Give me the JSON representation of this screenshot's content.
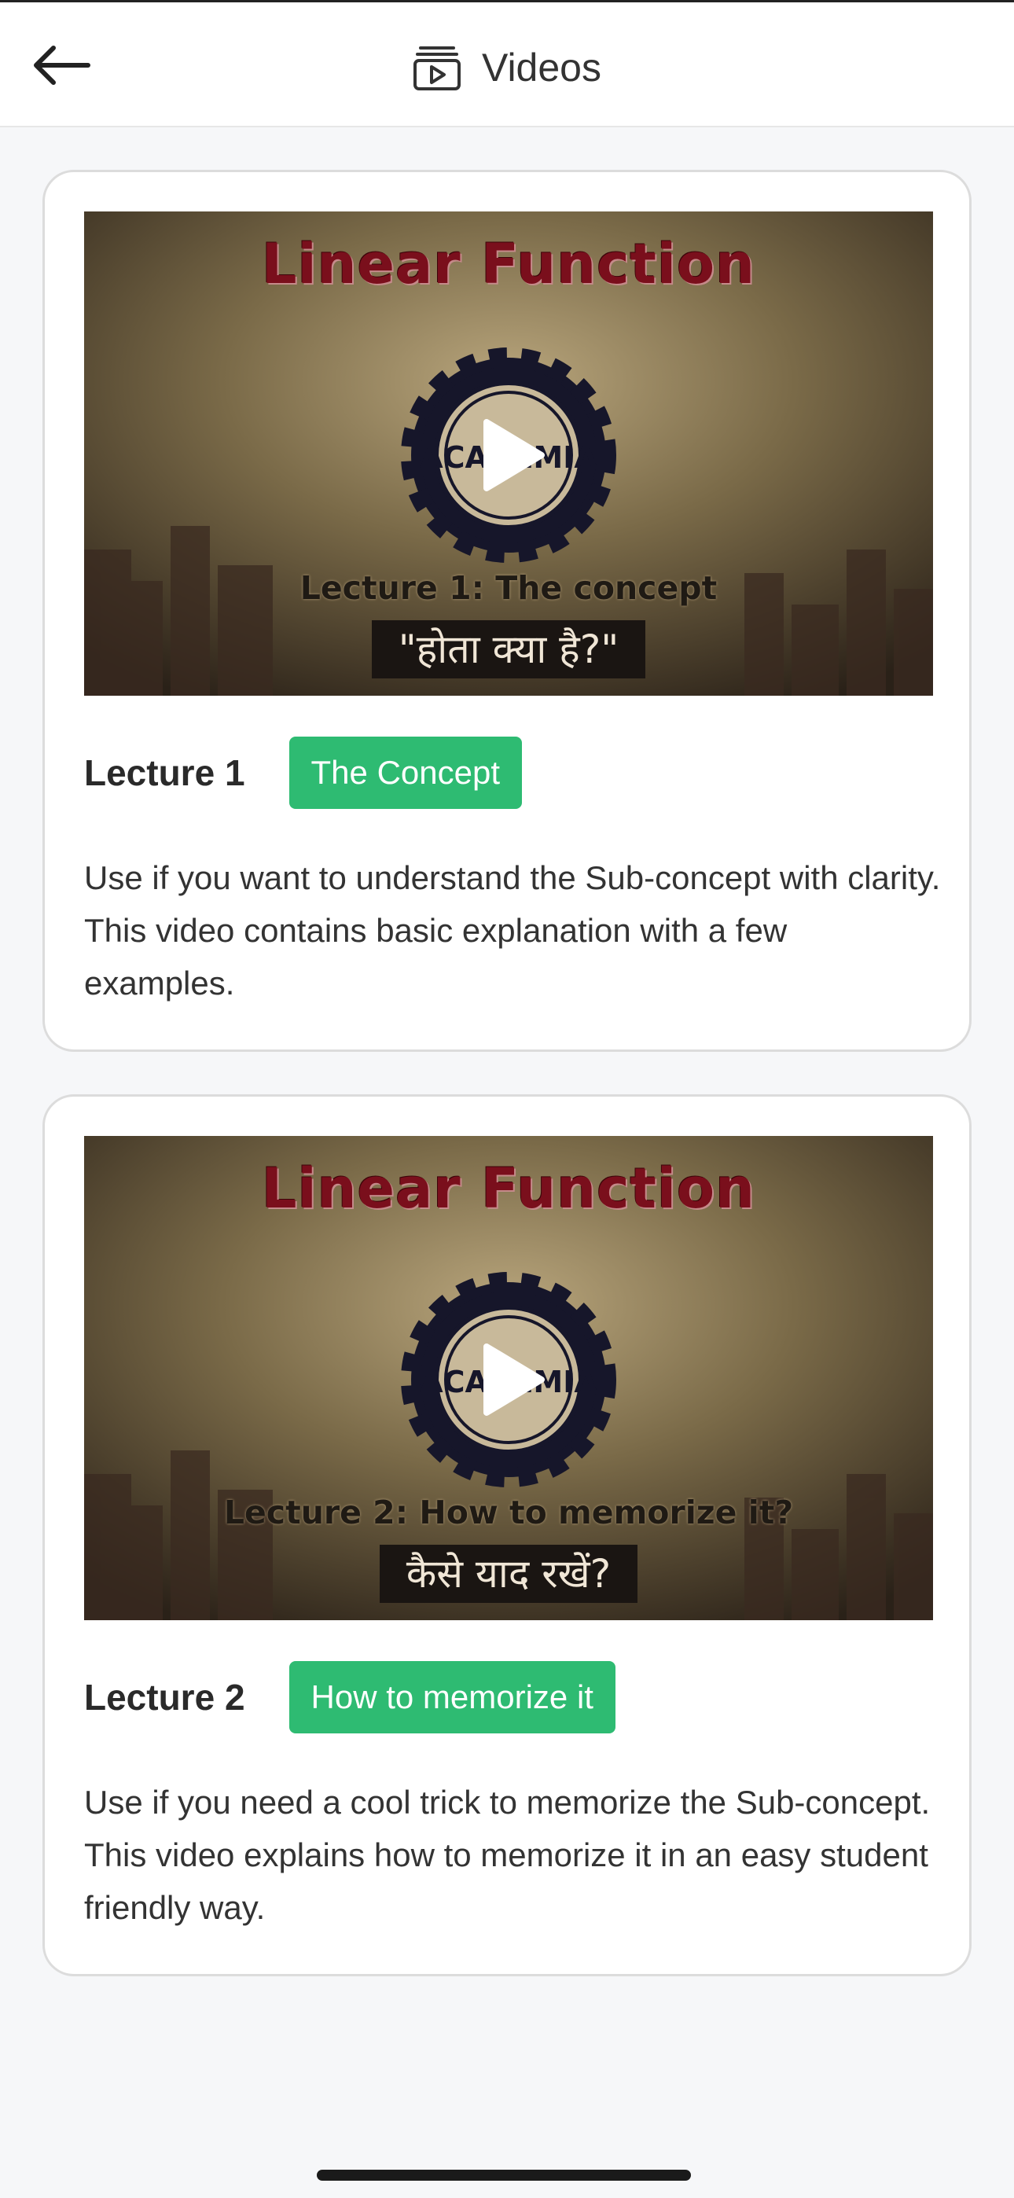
{
  "header": {
    "title": "Videos",
    "back_icon": "arrow-left-icon",
    "title_icon": "video-library-icon"
  },
  "cards": [
    {
      "thumbnail": {
        "title": "Linear Function",
        "badge_text": "ACADEMIA",
        "lecture_text": "Lecture 1: The concept",
        "hindi_text": "\"होता क्या है?\""
      },
      "lecture_label": "Lecture 1",
      "tag": "The Concept",
      "description": "Use if you want to understand the Sub-concept with clarity. This video contains basic explanation with a few examples."
    },
    {
      "thumbnail": {
        "title": "Linear Function",
        "badge_text": "ACADEMIA",
        "lecture_text": "Lecture 2: How to memorize it?",
        "hindi_text": "कैसे याद रखें?"
      },
      "lecture_label": "Lecture 2",
      "tag": "How to memorize it",
      "description": "Use if you need a cool trick to memorize the Sub-concept. This video explains how to memorize it in an easy student friendly way."
    }
  ],
  "colors": {
    "accent_green": "#2ebb72",
    "thumb_title_red": "#7a0f1c"
  }
}
